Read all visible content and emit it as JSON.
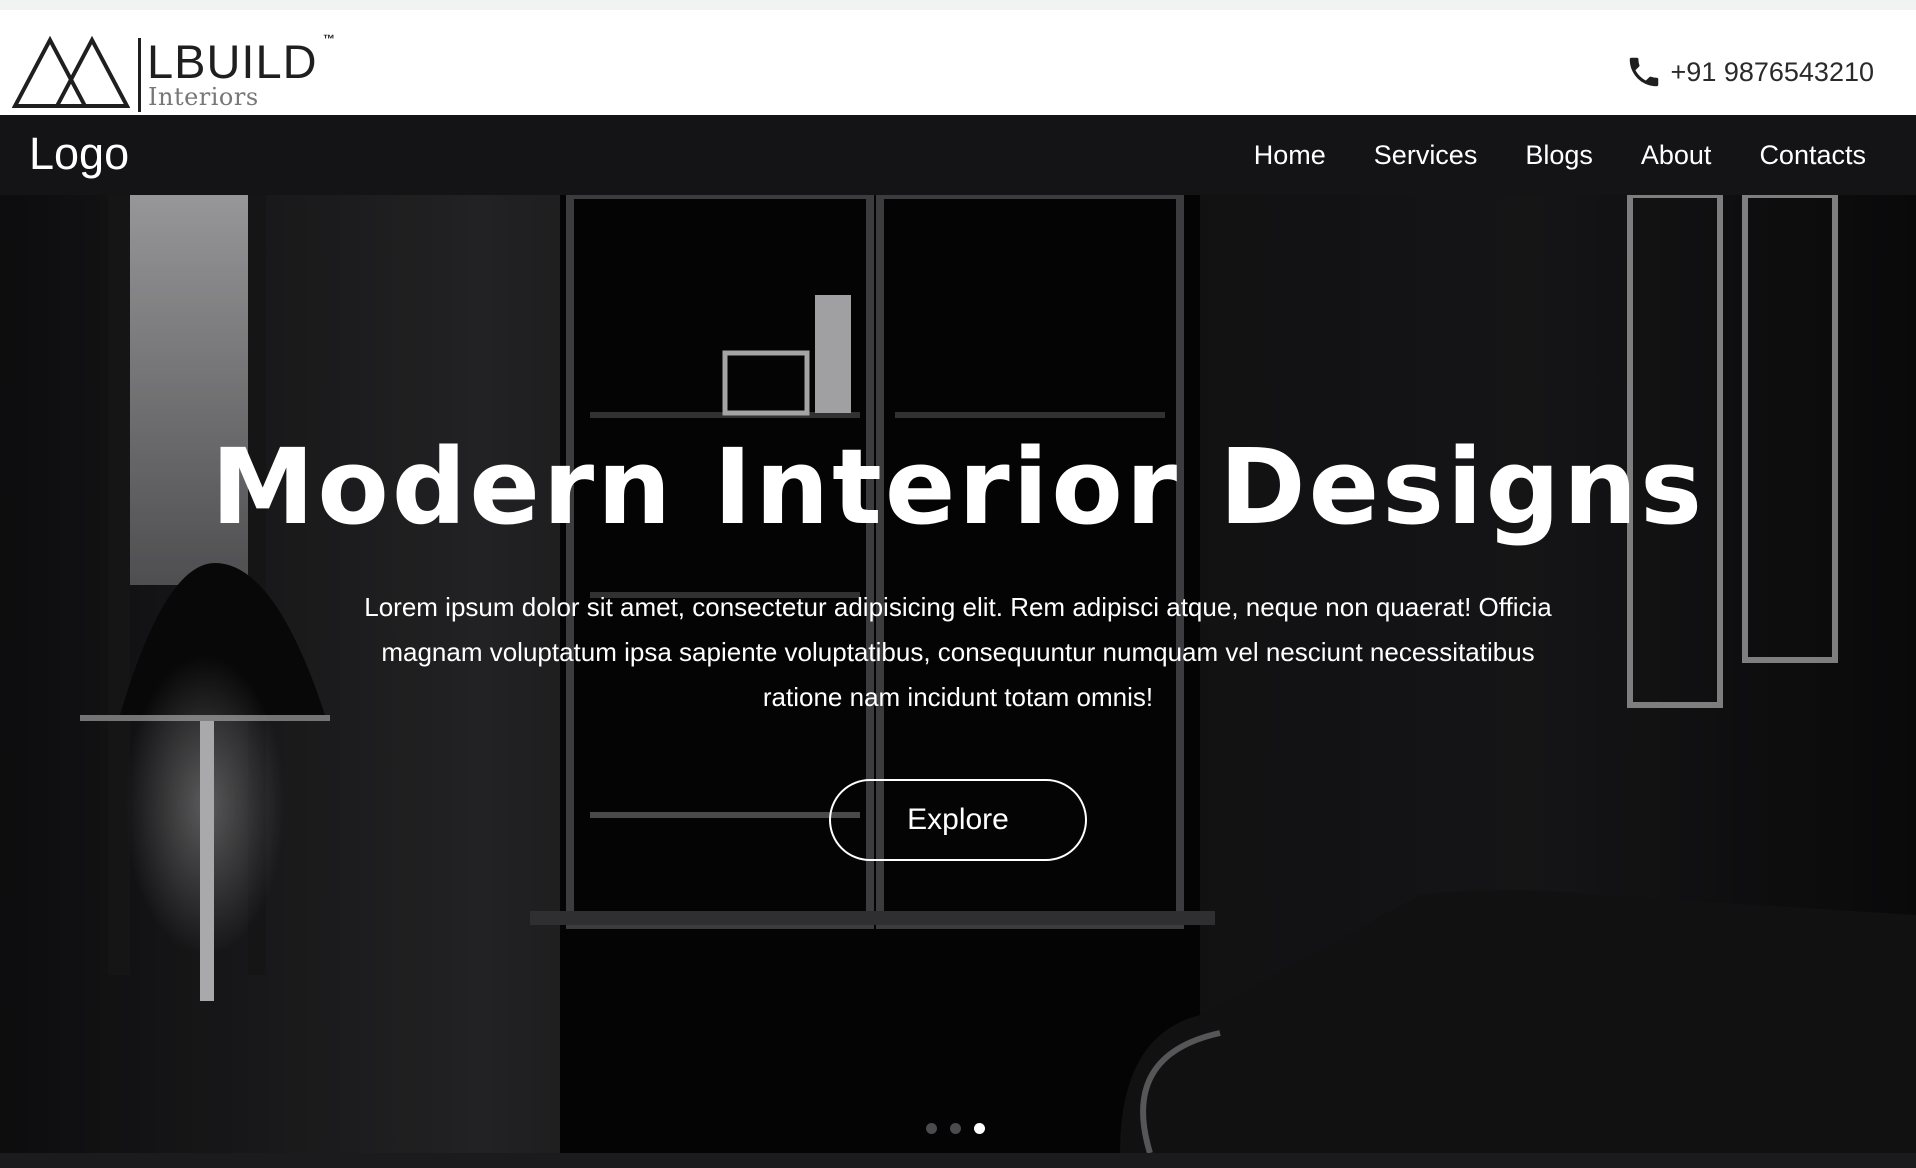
{
  "brand": {
    "name": "LBUILD",
    "trademark": "™",
    "subtitle": "Interiors",
    "mark_icon": "triangle-mountains-icon"
  },
  "contact": {
    "phone_icon": "phone-icon",
    "phone": "+91 9876543210"
  },
  "nav": {
    "logo": "Logo",
    "links": [
      "Home",
      "Services",
      "Blogs",
      "About",
      "Contacts"
    ]
  },
  "hero": {
    "title": "Modern Interior Designs",
    "text": "Lorem ipsum dolor sit amet, consectetur adipisicing elit. Rem adipisci atque, neque non quaerat! Officia magnam voluptatum ipsa sapiente voluptatibus, consequuntur numquam vel nesciunt necessitatibus ratione nam incidunt totam omnis!",
    "button": "Explore",
    "slides_total": 3,
    "active_slide": 3
  },
  "colors": {
    "nav_bg": "#141417",
    "hero_bg": "#0d0d0e",
    "text_light": "#ffffff",
    "brand_dark": "#1f1f1f"
  }
}
